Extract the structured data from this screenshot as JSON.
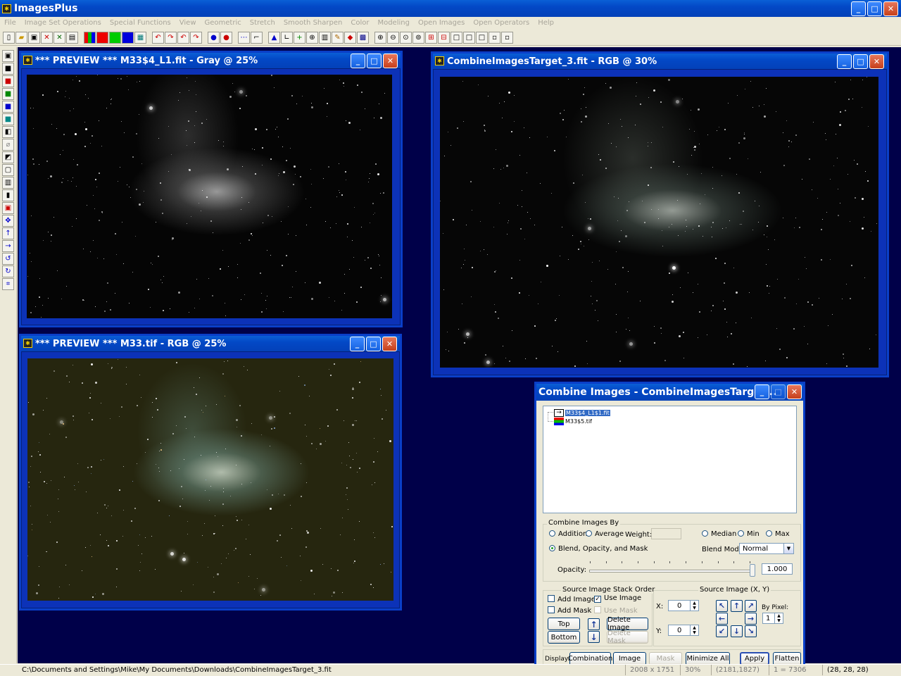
{
  "app": {
    "title": "ImagesPlus",
    "icon": "app-icon"
  },
  "menu": [
    "File",
    "Image Set Operations",
    "Special Functions",
    "View",
    "Geometric",
    "Stretch",
    "Smooth Sharpen",
    "Color",
    "Modeling",
    "Open Images",
    "Open Operators",
    "Help"
  ],
  "windows": {
    "preview_gray": {
      "title": "*** PREVIEW *** M33$4_L1.fit - Gray @ 25%"
    },
    "target": {
      "title": "CombineImagesTarget_3.fit - RGB @ 30%"
    },
    "preview_rgb": {
      "title": "*** PREVIEW *** M33.tif - RGB @ 25%"
    }
  },
  "dialog": {
    "title": "Combine Images - CombineImagesTarget...",
    "list": [
      {
        "name": "M33$4_L1$1.fit",
        "selected": true,
        "icon": "arrow-layer-icon"
      },
      {
        "name": "M33$5.tif",
        "selected": false,
        "icon": "rgb-layer-icon"
      }
    ],
    "combine_by": {
      "label": "Combine Images By",
      "addition": "Addition",
      "average": "Average",
      "weight_label": "Weight:",
      "median": "Median",
      "min": "Min",
      "max": "Max",
      "blend": "Blend, Opacity, and Mask",
      "blend_mode_label": "Blend Mode:",
      "blend_mode": "Normal",
      "opacity_label": "Opacity:",
      "opacity": "1.000"
    },
    "stack": {
      "label": "Source Image Stack Order",
      "add_image": "Add Image",
      "use_image": "Use Image",
      "add_mask": "Add Mask",
      "use_mask": "Use Mask",
      "top": "Top",
      "bottom": "Bottom",
      "delete_image": "Delete Image",
      "delete_mask": "Delete Mask"
    },
    "source": {
      "label": "Source Image (X, Y)",
      "x_label": "X:",
      "x": "0",
      "y_label": "Y:",
      "y": "0",
      "by_pixel_label": "By Pixel:",
      "by_pixel": "1"
    },
    "display": {
      "label": "Display:",
      "combination": "Combination",
      "image": "Image",
      "mask": "Mask",
      "minimize_all": "Minimize All",
      "apply": "Apply",
      "flatten": "Flatten"
    }
  },
  "status": {
    "path": "C:\\Documents and Settings\\Mike\\My Documents\\Downloads\\CombineImagesTarget_3.fit",
    "size": "2008 x 1751",
    "zoom": "30%",
    "coords": "(2181,1827)",
    "ratio": "1 = 7306",
    "pixel": "(28, 28, 28)"
  }
}
